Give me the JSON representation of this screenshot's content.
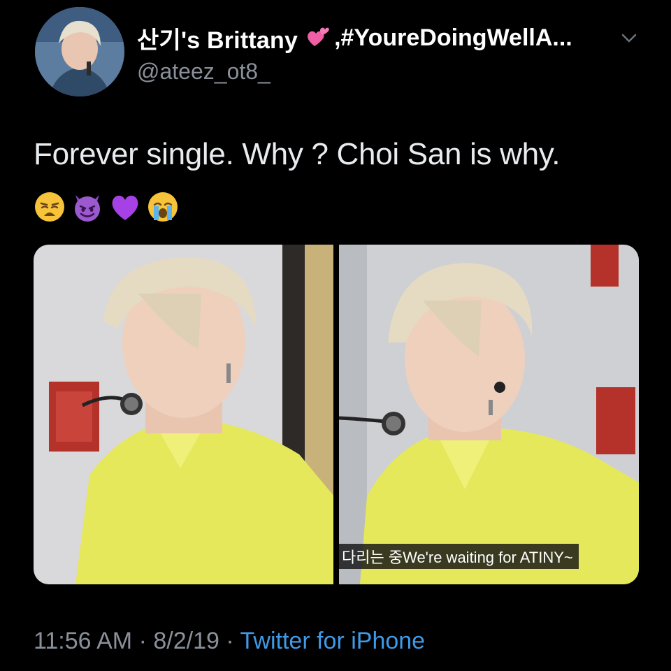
{
  "profile": {
    "display_name": "산기's Brittany",
    "name_emoji": "two-hearts-icon",
    "name_suffix": ",#YoureDoingWellA...",
    "handle": "@ateez_ot8_"
  },
  "tweet": {
    "text": "Forever single. Why ? Choi San is why.",
    "emojis": [
      "weary-face-icon",
      "smiling-imp-icon",
      "purple-heart-icon",
      "loudly-crying-face-icon"
    ]
  },
  "media": {
    "photo_count": 2,
    "subtitle_korean": "다리는 중",
    "subtitle_english": "We're waiting for ATINY~"
  },
  "meta": {
    "time": "11:56 AM",
    "separator": "·",
    "date": "8/2/19",
    "source": "Twitter for iPhone"
  },
  "colors": {
    "background": "#000000",
    "text": "#ffffff",
    "secondary": "#8a9099",
    "link": "#3f9ae8",
    "shirt": "#e4e85a"
  }
}
